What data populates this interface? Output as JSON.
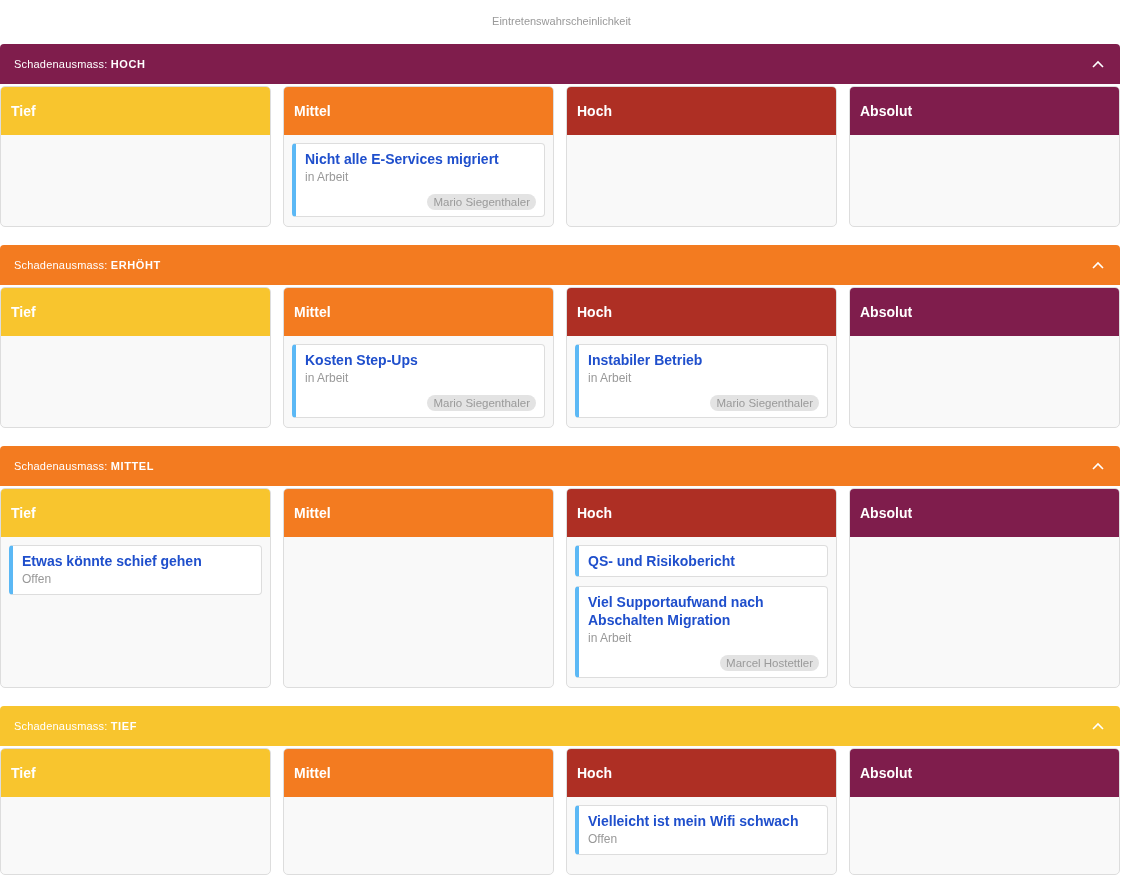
{
  "axis_title": "Eintretenswahrscheinlichkeit",
  "sections": [
    {
      "label": "Schadenausmass: **HOCH**",
      "color": "#7f1d4c",
      "expanded": true,
      "columns": [
        {
          "title": "Tief",
          "color": "#f8c52e"
        },
        {
          "title": "Mittel",
          "color": "#f37b20",
          "cards": [
            {
              "title": "Nicht alle E-Services migriert",
              "status": "in Arbeit",
              "assignee": "Mario Siegenthaler"
            }
          ]
        },
        {
          "title": "Hoch",
          "color": "#ae2f24"
        },
        {
          "title": "Absolut",
          "color": "#7f1d4c"
        }
      ]
    },
    {
      "label": "Schadenausmass: **ERHÖHT**",
      "color": "#f37b20",
      "expanded": true,
      "columns": [
        {
          "title": "Tief",
          "color": "#f8c52e"
        },
        {
          "title": "Mittel",
          "color": "#f37b20",
          "cards": [
            {
              "title": "Kosten Step-Ups",
              "status": "in Arbeit",
              "assignee": "Mario Siegenthaler"
            }
          ]
        },
        {
          "title": "Hoch",
          "color": "#ae2f24",
          "cards": [
            {
              "title": "Instabiler Betrieb",
              "status": "in Arbeit",
              "assignee": "Mario Siegenthaler"
            }
          ]
        },
        {
          "title": "Absolut",
          "color": "#7f1d4c"
        }
      ]
    },
    {
      "label": "Schadenausmass: **MITTEL**",
      "color": "#f37b20",
      "expanded": true,
      "columns": [
        {
          "title": "Tief",
          "color": "#f8c52e",
          "cards": [
            {
              "title": "Etwas könnte schief gehen",
              "status": "Offen"
            }
          ]
        },
        {
          "title": "Mittel",
          "color": "#f37b20"
        },
        {
          "title": "Hoch",
          "color": "#ae2f24",
          "cards": [
            {
              "title": "QS- und Risikobericht"
            },
            {
              "title": "Viel Supportaufwand nach Abschalten Migration",
              "status": "in Arbeit",
              "assignee": "Marcel Hostettler"
            }
          ]
        },
        {
          "title": "Absolut",
          "color": "#7f1d4c"
        }
      ]
    },
    {
      "label": "Schadenausmass: **TIEF**",
      "color": "#f8c52e",
      "expanded": true,
      "columns": [
        {
          "title": "Tief",
          "color": "#f8c52e"
        },
        {
          "title": "Mittel",
          "color": "#f37b20"
        },
        {
          "title": "Hoch",
          "color": "#ae2f24",
          "cards": [
            {
              "title": "Vielleicht ist mein Wifi schwach",
              "status": "Offen"
            }
          ]
        },
        {
          "title": "Absolut",
          "color": "#7f1d4c"
        }
      ]
    }
  ]
}
